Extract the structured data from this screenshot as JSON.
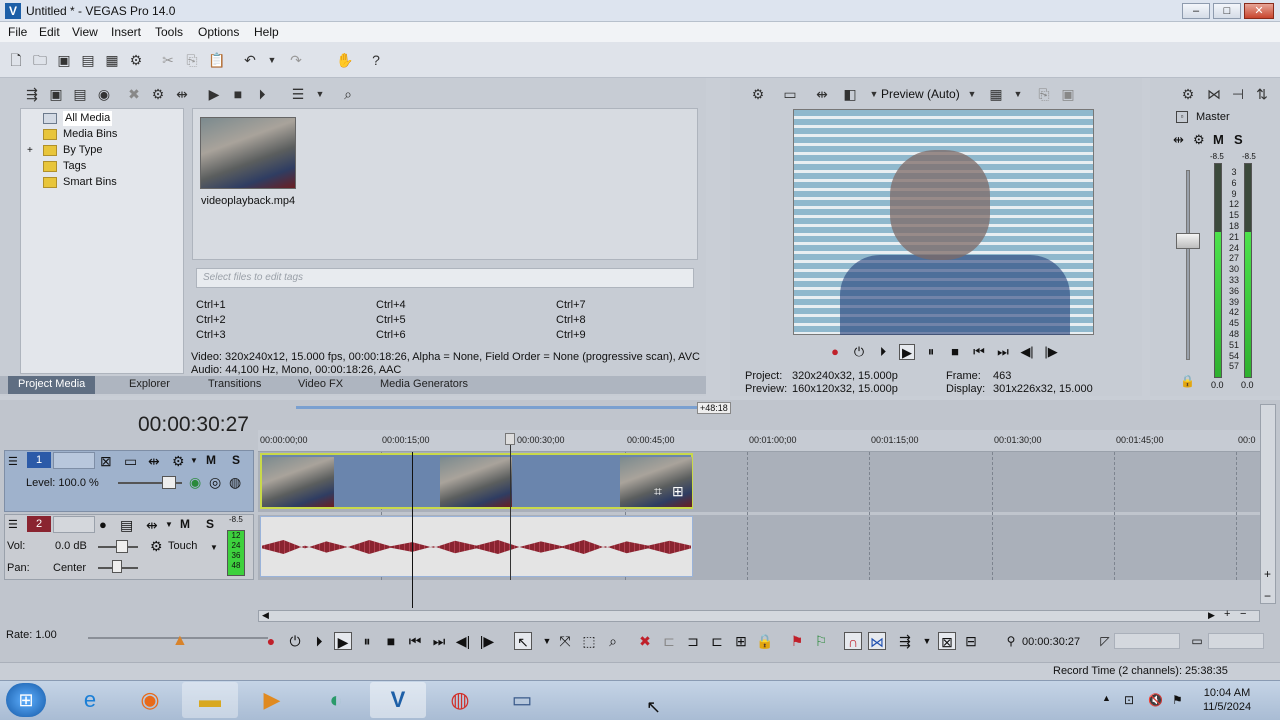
{
  "window": {
    "title": "Untitled * - VEGAS Pro 14.0",
    "app_icon": "V",
    "min": "–",
    "max": "□",
    "close": "✕"
  },
  "menu": [
    "File",
    "Edit",
    "View",
    "Insert",
    "Tools",
    "Options",
    "Help"
  ],
  "project_media": {
    "tree": [
      "All Media",
      "Media Bins",
      "By Type",
      "Tags",
      "Smart Bins"
    ],
    "expander": "+",
    "file_name": "videoplayback.mp4",
    "tags_placeholder": "Select files to edit tags",
    "shortcuts": [
      "Ctrl+1",
      "Ctrl+4",
      "Ctrl+7",
      "Ctrl+2",
      "Ctrl+5",
      "Ctrl+8",
      "Ctrl+3",
      "Ctrl+6",
      "Ctrl+9"
    ],
    "info_video": "Video: 320x240x12, 15.000 fps, 00:00:18:26, Alpha = None, Field Order = None (progressive scan), AVC",
    "info_audio": "Audio: 44,100 Hz, Mono, 00:00:18:26, AAC",
    "tabs": [
      "Project Media",
      "Explorer",
      "Transitions",
      "Video FX",
      "Media Generators"
    ]
  },
  "preview": {
    "mode": "Preview (Auto)",
    "project_label": "Project:",
    "project_value": "320x240x32, 15.000p",
    "preview_label": "Preview:",
    "preview_value": "160x120x32, 15.000p",
    "frame_label": "Frame:",
    "frame_value": "463",
    "display_label": "Display:",
    "display_value": "301x226x32, 15.000"
  },
  "master": {
    "label": "Master",
    "m": "M",
    "s": "S",
    "peak_left": "-8.5",
    "peak_right": "-8.5",
    "scale": [
      "3",
      "6",
      "9",
      "12",
      "15",
      "18",
      "21",
      "24",
      "27",
      "30",
      "33",
      "36",
      "39",
      "42",
      "45",
      "48",
      "51",
      "54",
      "57"
    ],
    "bottom_left": "0.0",
    "bottom_right": "0.0",
    "level_left": 0.68,
    "level_right": 0.68
  },
  "timeline": {
    "time": "00:00:30:27",
    "end_marker": "+48:18",
    "ruler": [
      "00:00:00;00",
      "00:00:15;00",
      "00:00:30;00",
      "00:00:45;00",
      "00:01:00;00",
      "00:01:15;00",
      "00:01:30;00",
      "00:01:45;00",
      "00:0"
    ],
    "track1": {
      "number": "1",
      "level": "Level: 100.0 %",
      "m": "M",
      "s": "S"
    },
    "track2": {
      "number": "2",
      "vol_label": "Vol:",
      "vol": "0.0 dB",
      "pan_label": "Pan:",
      "pan": "Center",
      "mode": "Touch",
      "m": "M",
      "s": "S",
      "peak": "-8.5",
      "meter": [
        "12",
        "24",
        "36",
        "48"
      ]
    }
  },
  "transport": {
    "rate": "Rate: 1.00",
    "time": "00:00:30:27"
  },
  "status": {
    "record_time": "Record Time (2 channels): 25:38:35"
  },
  "taskbar": {
    "time": "10:04 AM",
    "date": "11/5/2024"
  }
}
